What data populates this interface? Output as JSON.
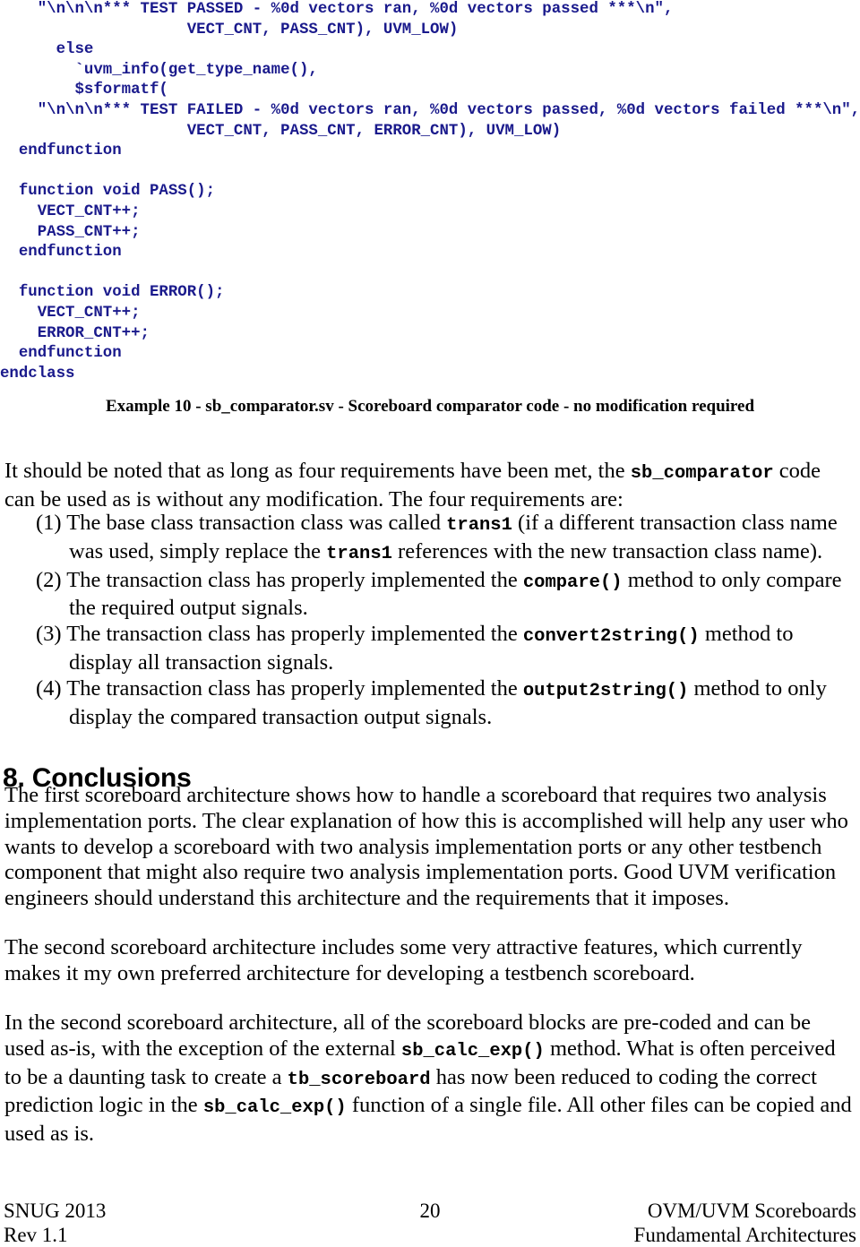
{
  "document": {
    "page_number": "20",
    "background_color": "#ffffff",
    "code_color": "#1a1a8c",
    "text_color": "#000000"
  },
  "code_listing": {
    "name": "sb_comparator.sv",
    "lines": [
      "    \"\\n\\n\\n*** TEST PASSED - %0d vectors ran, %0d vectors passed ***\\n\",",
      "                    VECT_CNT, PASS_CNT), UVM_LOW)",
      "      else",
      "        `uvm_info(get_type_name(),",
      "        $sformatf(",
      "    \"\\n\\n\\n*** TEST FAILED - %0d vectors ran, %0d vectors passed, %0d vectors failed ***\\n\",",
      "                    VECT_CNT, PASS_CNT, ERROR_CNT), UVM_LOW)",
      "  endfunction",
      "",
      "  function void PASS();",
      "    VECT_CNT++;",
      "    PASS_CNT++;",
      "  endfunction",
      "",
      "  function void ERROR();",
      "    VECT_CNT++;",
      "    ERROR_CNT++;",
      "  endfunction",
      "endclass"
    ]
  },
  "figure_caption": "Example 10 - sb_comparator.sv - Scoreboard comparator code - no modification required",
  "intro_paragraph": {
    "part1": "It should be noted that as long as four requirements have been met, the ",
    "code1": "sb_comparator",
    "part2": " code can be used as is without any modification. The four requirements are:"
  },
  "requirements": [
    {
      "marker": "(1)",
      "part1": " The base class transaction class was called ",
      "code1": "trans1",
      "part2": " (if a different transaction class name was used, simply replace the ",
      "code2": "trans1",
      "part3": " references with the new transaction class name)."
    },
    {
      "marker": "(2)",
      "part1": " The transaction class has properly implemented the ",
      "code1": "compare()",
      "part2": " method to only compare the required output signals.",
      "code2": "",
      "part3": ""
    },
    {
      "marker": "(3)",
      "part1": " The transaction class has properly implemented the ",
      "code1": "convert2string()",
      "part2": " method to display all transaction signals.",
      "code2": "",
      "part3": ""
    },
    {
      "marker": "(4)",
      "part1": " The transaction class has properly implemented the ",
      "code1": "output2string()",
      "part2": " method to only display the compared transaction output signals.",
      "code2": "",
      "part3": ""
    }
  ],
  "section": {
    "heading": "8.  Conclusions",
    "paragraph1": "The first scoreboard architecture shows how to handle a scoreboard that requires two analysis implementation ports. The clear explanation of how this is accomplished will help any user who wants to develop a scoreboard with two analysis implementation ports or any other testbench component that might also require two analysis implementation ports. Good UVM verification engineers should understand this architecture and the requirements that it imposes.",
    "paragraph2": "The second scoreboard architecture includes some very attractive features, which currently makes it my own preferred architecture for developing a testbench scoreboard.",
    "paragraph3": {
      "part1": "In the second scoreboard architecture, all of the scoreboard blocks are pre-coded and can be used as-is, with the exception of the external ",
      "code1": "sb_calc_exp()",
      "part2": " method. What is often perceived to be a daunting task to create a ",
      "code2": "tb_scoreboard",
      "part3": " has now been reduced to coding the correct prediction logic in the ",
      "code3": "sb_calc_exp()",
      "part4": " function of a single file. All other files can be copied and used as is."
    }
  },
  "footer": {
    "left_line1": "SNUG 2013",
    "left_line2": "Rev 1.1",
    "center": "20",
    "right_line1": "OVM/UVM Scoreboards",
    "right_line2": "Fundamental Architectures"
  }
}
